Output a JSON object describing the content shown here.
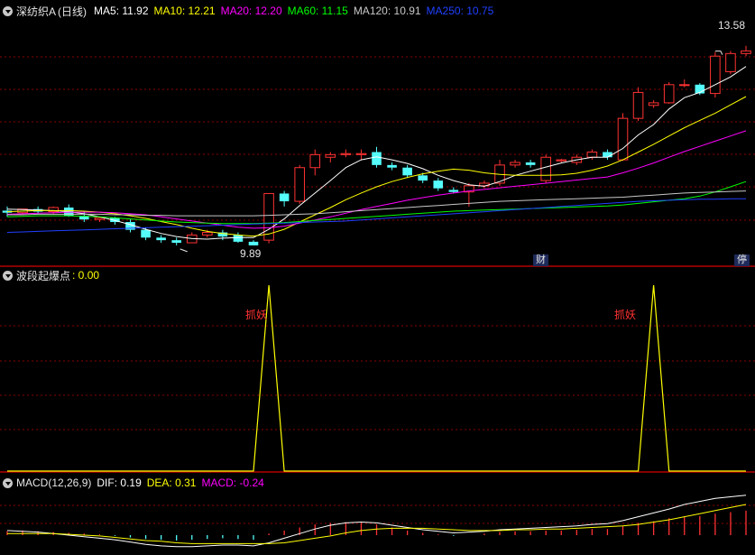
{
  "header": {
    "title": "深纺织A",
    "period": "(日线)",
    "ma": [
      {
        "label": "MA5:",
        "value": "11.92",
        "color": "#ffffff"
      },
      {
        "label": "MA10:",
        "value": "12.21",
        "color": "#ffff00"
      },
      {
        "label": "MA20:",
        "value": "12.20",
        "color": "#ff00ff"
      },
      {
        "label": "MA60:",
        "value": "11.15",
        "color": "#00ff00"
      },
      {
        "label": "MA120:",
        "value": "10.91",
        "color": "#c8c8c8"
      },
      {
        "label": "MA250:",
        "value": "10.75",
        "color": "#2040ff"
      }
    ]
  },
  "indicator": {
    "name": "波段起爆点",
    "value": ": 0.00",
    "signal_text": "抓妖"
  },
  "macd": {
    "name": "MACD(12,26,9)",
    "dif_label": "DIF:",
    "dif": "0.19",
    "dea_label": "DEA:",
    "dea": "0.31",
    "macd_label": "MACD:",
    "macd": "-0.24"
  },
  "markers": {
    "cai": "财",
    "ting": "停"
  },
  "colors": {
    "up": "#ff3232",
    "down": "#54fcfc",
    "grid": "#8b0000"
  },
  "chart_data": [
    {
      "type": "candlestick",
      "title": "",
      "ylim": [
        9.5,
        14.2
      ],
      "max_label": "13.58",
      "min_label": "9.89",
      "candles": [
        [
          10.52,
          10.6,
          10.4,
          10.48
        ],
        [
          10.48,
          10.55,
          10.45,
          10.55
        ],
        [
          10.55,
          10.6,
          10.45,
          10.5
        ],
        [
          10.5,
          10.6,
          10.45,
          10.58
        ],
        [
          10.58,
          10.64,
          10.4,
          10.42
        ],
        [
          10.42,
          10.5,
          10.3,
          10.35
        ],
        [
          10.35,
          10.4,
          10.3,
          10.38
        ],
        [
          10.38,
          10.4,
          10.25,
          10.3
        ],
        [
          10.3,
          10.35,
          10.1,
          10.15
        ],
        [
          10.15,
          10.2,
          9.95,
          10.0
        ],
        [
          10.0,
          10.05,
          9.9,
          9.95
        ],
        [
          9.95,
          10.0,
          9.85,
          9.9
        ],
        [
          9.9,
          10.1,
          9.9,
          10.05
        ],
        [
          10.05,
          10.15,
          10.0,
          10.1
        ],
        [
          10.1,
          10.15,
          9.95,
          10.02
        ],
        [
          10.05,
          10.1,
          9.9,
          9.92
        ],
        [
          9.92,
          9.95,
          9.85,
          9.85
        ],
        [
          9.95,
          10.85,
          9.89,
          10.85
        ],
        [
          10.85,
          10.9,
          10.6,
          10.7
        ],
        [
          10.7,
          11.4,
          10.65,
          11.35
        ],
        [
          11.35,
          11.7,
          11.2,
          11.6
        ],
        [
          11.55,
          11.65,
          11.45,
          11.6
        ],
        [
          11.6,
          11.7,
          11.55,
          11.62
        ],
        [
          11.6,
          11.7,
          11.5,
          11.62
        ],
        [
          11.65,
          11.75,
          11.35,
          11.4
        ],
        [
          11.4,
          11.45,
          11.3,
          11.35
        ],
        [
          11.35,
          11.4,
          11.15,
          11.2
        ],
        [
          11.2,
          11.25,
          11.05,
          11.1
        ],
        [
          11.1,
          11.15,
          10.9,
          10.95
        ],
        [
          10.92,
          10.97,
          10.85,
          10.88
        ],
        [
          10.88,
          11.05,
          10.6,
          11.0
        ],
        [
          11.0,
          11.1,
          10.95,
          11.05
        ],
        [
          11.05,
          11.5,
          11.0,
          11.4
        ],
        [
          11.4,
          11.5,
          11.35,
          11.45
        ],
        [
          11.45,
          11.5,
          11.35,
          11.4
        ],
        [
          11.1,
          11.6,
          11.05,
          11.55
        ],
        [
          11.48,
          11.52,
          11.45,
          11.5
        ],
        [
          11.45,
          11.6,
          11.4,
          11.55
        ],
        [
          11.55,
          11.7,
          11.5,
          11.65
        ],
        [
          11.65,
          11.7,
          11.5,
          11.55
        ],
        [
          11.5,
          12.4,
          11.48,
          12.3
        ],
        [
          12.3,
          12.9,
          12.25,
          12.8
        ],
        [
          12.55,
          12.65,
          12.5,
          12.6
        ],
        [
          12.6,
          13.0,
          12.58,
          12.95
        ],
        [
          12.95,
          13.05,
          12.9,
          12.95
        ],
        [
          12.95,
          12.98,
          12.75,
          12.78
        ],
        [
          12.78,
          13.58,
          12.7,
          13.5
        ],
        [
          13.2,
          13.6,
          13.15,
          13.55
        ],
        [
          13.55,
          13.7,
          13.5,
          13.6
        ]
      ],
      "ma_series": [
        {
          "name": "MA5",
          "color": "#ffffff",
          "values": [
            10.55,
            10.54,
            10.53,
            10.52,
            10.5,
            10.46,
            10.4,
            10.33,
            10.25,
            10.16,
            10.08,
            10.02,
            9.98,
            9.97,
            9.99,
            10.0,
            10.0,
            10.16,
            10.36,
            10.62,
            10.86,
            11.1,
            11.35,
            11.5,
            11.56,
            11.5,
            11.43,
            11.33,
            11.2,
            11.1,
            11.02,
            10.99,
            11.08,
            11.2,
            11.28,
            11.36,
            11.44,
            11.5,
            11.55,
            11.55,
            11.72,
            11.98,
            12.18,
            12.48,
            12.7,
            12.8,
            12.95,
            13.1,
            13.3
          ]
        },
        {
          "name": "MA10",
          "color": "#ffff00",
          "values": [
            10.5,
            10.51,
            10.52,
            10.52,
            10.52,
            10.51,
            10.49,
            10.46,
            10.42,
            10.37,
            10.31,
            10.25,
            10.18,
            10.12,
            10.08,
            10.05,
            10.03,
            10.07,
            10.16,
            10.3,
            10.44,
            10.58,
            10.73,
            10.86,
            10.98,
            11.08,
            11.16,
            11.23,
            11.28,
            11.32,
            11.3,
            11.25,
            11.22,
            11.2,
            11.2,
            11.2,
            11.21,
            11.24,
            11.3,
            11.38,
            11.5,
            11.65,
            11.8,
            11.96,
            12.12,
            12.26,
            12.4,
            12.56,
            12.72
          ]
        },
        {
          "name": "MA20",
          "color": "#ff00ff",
          "values": [
            10.45,
            10.46,
            10.47,
            10.48,
            10.49,
            10.49,
            10.49,
            10.48,
            10.46,
            10.44,
            10.4,
            10.36,
            10.32,
            10.28,
            10.24,
            10.2,
            10.18,
            10.19,
            10.22,
            10.28,
            10.34,
            10.4,
            10.47,
            10.54,
            10.6,
            10.66,
            10.72,
            10.77,
            10.82,
            10.86,
            10.9,
            10.93,
            10.96,
            10.99,
            11.02,
            11.05,
            11.08,
            11.11,
            11.14,
            11.17,
            11.25,
            11.34,
            11.44,
            11.55,
            11.66,
            11.76,
            11.86,
            11.96,
            12.06
          ]
        },
        {
          "name": "MA60",
          "color": "#00ff00",
          "values": [
            10.4,
            10.41,
            10.42,
            10.42,
            10.42,
            10.41,
            10.4,
            10.38,
            10.36,
            10.34,
            10.32,
            10.3,
            10.29,
            10.28,
            10.27,
            10.27,
            10.27,
            10.28,
            10.29,
            10.31,
            10.33,
            10.35,
            10.37,
            10.39,
            10.41,
            10.43,
            10.45,
            10.47,
            10.49,
            10.51,
            10.52,
            10.53,
            10.54,
            10.55,
            10.56,
            10.57,
            10.58,
            10.59,
            10.6,
            10.61,
            10.63,
            10.66,
            10.69,
            10.72,
            10.75,
            10.8,
            10.88,
            10.98,
            11.08
          ]
        },
        {
          "name": "MA120",
          "color": "#c8c8c8",
          "values": [
            10.44,
            10.44,
            10.45,
            10.45,
            10.45,
            10.45,
            10.45,
            10.44,
            10.44,
            10.43,
            10.43,
            10.42,
            10.42,
            10.42,
            10.42,
            10.42,
            10.42,
            10.43,
            10.44,
            10.45,
            10.46,
            10.48,
            10.5,
            10.52,
            10.54,
            10.56,
            10.58,
            10.6,
            10.62,
            10.64,
            10.66,
            10.68,
            10.7,
            10.71,
            10.72,
            10.73,
            10.74,
            10.75,
            10.76,
            10.77,
            10.78,
            10.8,
            10.82,
            10.84,
            10.86,
            10.87,
            10.88,
            10.89,
            10.9
          ]
        },
        {
          "name": "MA250",
          "color": "#2040ff",
          "values": [
            10.1,
            10.11,
            10.12,
            10.13,
            10.14,
            10.15,
            10.16,
            10.17,
            10.18,
            10.19,
            10.2,
            10.21,
            10.22,
            10.23,
            10.24,
            10.25,
            10.26,
            10.27,
            10.28,
            10.29,
            10.3,
            10.31,
            10.32,
            10.34,
            10.36,
            10.38,
            10.4,
            10.42,
            10.44,
            10.46,
            10.48,
            10.5,
            10.52,
            10.54,
            10.56,
            10.58,
            10.6,
            10.62,
            10.64,
            10.66,
            10.68,
            10.7,
            10.71,
            10.72,
            10.73,
            10.74,
            10.74,
            10.75,
            10.75
          ]
        }
      ]
    },
    {
      "type": "line",
      "title": "",
      "ylim": [
        0,
        1
      ],
      "values": [
        0,
        0,
        0,
        0,
        0,
        0,
        0,
        0,
        0,
        0,
        0,
        0,
        0,
        0,
        0,
        0,
        0,
        1,
        0,
        0,
        0,
        0,
        0,
        0,
        0,
        0,
        0,
        0,
        0,
        0,
        0,
        0,
        0,
        0,
        0,
        0,
        0,
        0,
        0,
        0,
        0,
        0,
        1,
        0,
        0,
        0,
        0,
        0,
        0
      ],
      "color": "#ffff00"
    },
    {
      "type": "bar",
      "title": "",
      "ylim": [
        -0.5,
        0.5
      ],
      "hist": [
        0.05,
        0.06,
        0.05,
        0.04,
        0.03,
        0.02,
        0.01,
        -0.01,
        -0.03,
        -0.05,
        -0.06,
        -0.07,
        -0.06,
        -0.05,
        -0.04,
        -0.05,
        -0.06,
        0.02,
        0.06,
        0.1,
        0.14,
        0.16,
        0.17,
        0.16,
        0.14,
        0.1,
        0.06,
        0.03,
        0.01,
        -0.01,
        0.0,
        0.02,
        0.04,
        0.05,
        0.05,
        0.06,
        0.06,
        0.07,
        0.08,
        0.08,
        0.12,
        0.16,
        0.18,
        0.22,
        0.24,
        0.25,
        0.28,
        0.3,
        0.32
      ],
      "dif": [
        0.06,
        0.05,
        0.04,
        0.02,
        0.0,
        -0.02,
        -0.04,
        -0.06,
        -0.09,
        -0.12,
        -0.14,
        -0.15,
        -0.15,
        -0.14,
        -0.13,
        -0.13,
        -0.14,
        -0.1,
        -0.04,
        0.02,
        0.08,
        0.13,
        0.16,
        0.17,
        0.16,
        0.13,
        0.1,
        0.07,
        0.05,
        0.03,
        0.04,
        0.05,
        0.07,
        0.08,
        0.09,
        0.1,
        0.11,
        0.12,
        0.14,
        0.15,
        0.19,
        0.24,
        0.29,
        0.34,
        0.4,
        0.44,
        0.48,
        0.5,
        0.52
      ],
      "dea": [
        0.02,
        0.02,
        0.02,
        0.02,
        0.01,
        0.0,
        -0.01,
        -0.03,
        -0.05,
        -0.07,
        -0.08,
        -0.1,
        -0.11,
        -0.11,
        -0.11,
        -0.11,
        -0.11,
        -0.11,
        -0.1,
        -0.07,
        -0.04,
        -0.01,
        0.03,
        0.06,
        0.08,
        0.09,
        0.09,
        0.09,
        0.08,
        0.07,
        0.06,
        0.06,
        0.06,
        0.07,
        0.07,
        0.08,
        0.08,
        0.09,
        0.1,
        0.11,
        0.12,
        0.14,
        0.17,
        0.2,
        0.24,
        0.28,
        0.32,
        0.36,
        0.4
      ]
    }
  ]
}
